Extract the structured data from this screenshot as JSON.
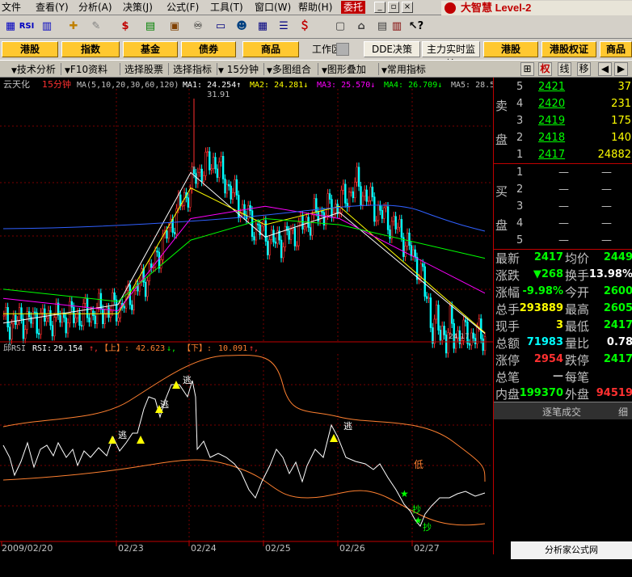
{
  "menu": {
    "items": [
      "文件",
      "查看(Y)",
      "分析(A)",
      "决策(J)",
      "公式(F)",
      "工具(T)",
      "窗口(W)",
      "帮助(H)",
      "委托"
    ],
    "brand": "大智慧 Level-2"
  },
  "sectors": {
    "left": [
      "港股",
      "指数",
      "基金",
      "债券",
      "商品"
    ],
    "workspace_label": "工作区",
    "right": [
      "DDE决策",
      "主力实时监控",
      "港股",
      "港股权证",
      "商品"
    ]
  },
  "toolbar2": {
    "items": [
      "技术分析",
      "F10资料",
      "选择股票",
      "选择指标",
      "15分钟",
      "多图组合",
      "图形叠加",
      "常用指标"
    ],
    "right_tabs": [
      "权",
      "线",
      "移"
    ]
  },
  "main_chart": {
    "stock_name": "云天化",
    "period": "15分钟",
    "ma_def": "MA(5,10,20,30,60,120)",
    "ma": [
      {
        "label": "MA1:",
        "value": "24.254",
        "arrow": "↑",
        "color": "#ffffff"
      },
      {
        "label": "MA2:",
        "value": "24.281",
        "arrow": "↓",
        "color": "#ffff00"
      },
      {
        "label": "MA3:",
        "value": "25.570",
        "arrow": "↓",
        "color": "#ff00ff"
      },
      {
        "label": "MA4:",
        "value": "26.709",
        "arrow": "↓",
        "color": "#00ff00"
      },
      {
        "label": "MA5:",
        "value": "28.5",
        "arrow": "",
        "color": "#c0c0c0"
      }
    ],
    "high_label": "31.91",
    "low_label": "24.17"
  },
  "rsi_chart": {
    "name": "邱RSI",
    "rsi_label": "RSI:",
    "rsi_value": "29.154",
    "rsi_arrow": "↑,",
    "upper_label": "【上】:",
    "upper_value": "42.623",
    "upper_arrow": "↓,",
    "lower_label": "【下】:",
    "lower_value": "10.091",
    "lower_arrow": "↑,",
    "signal_buy": "逃",
    "signal_low": "低",
    "signal_sell": "抄"
  },
  "x_axis": {
    "labels": [
      "2009/02/20",
      "02/23",
      "02/24",
      "02/25",
      "02/26",
      "02/27"
    ]
  },
  "order_book": {
    "sell_label_top": "卖",
    "sell_label_bottom": "盘",
    "buy_label_top": "买",
    "buy_label_bottom": "盘",
    "sell": [
      {
        "level": "5",
        "price": "2421",
        "volume": "37"
      },
      {
        "level": "4",
        "price": "2420",
        "volume": "231"
      },
      {
        "level": "3",
        "price": "2419",
        "volume": "175"
      },
      {
        "level": "2",
        "price": "2418",
        "volume": "140"
      },
      {
        "level": "1",
        "price": "2417",
        "volume": "24882"
      }
    ],
    "buy": [
      {
        "level": "1",
        "price": "—",
        "volume": "—"
      },
      {
        "level": "2",
        "price": "—",
        "volume": "—"
      },
      {
        "level": "3",
        "price": "—",
        "volume": "—"
      },
      {
        "level": "4",
        "price": "—",
        "volume": "—"
      },
      {
        "level": "5",
        "price": "—",
        "volume": "—"
      }
    ]
  },
  "quote": [
    {
      "l1": "最新",
      "v1": "2417",
      "c1": "#00ff00",
      "l2": "均价",
      "v2": "2449",
      "c2": "#00ff00"
    },
    {
      "l1": "涨跌",
      "v1": "▼268",
      "c1": "#00ff00",
      "l2": "换手",
      "v2": "13.98%",
      "c2": "#ffffff"
    },
    {
      "l1": "涨幅",
      "v1": "-9.98%",
      "c1": "#00ff00",
      "l2": "今开",
      "v2": "2600",
      "c2": "#00ff00"
    },
    {
      "l1": "总手",
      "v1": "293889",
      "c1": "#ffff00",
      "l2": "最高",
      "v2": "2605",
      "c2": "#00ff00"
    },
    {
      "l1": "现手",
      "v1": "3",
      "c1": "#ffff00",
      "l2": "最低",
      "v2": "2417",
      "c2": "#00ff00"
    },
    {
      "l1": "总额",
      "v1": "71983",
      "c1": "#00ffff",
      "l2": "量比",
      "v2": "0.78",
      "c2": "#ffffff"
    },
    {
      "l1": "涨停",
      "v1": "2954",
      "c1": "#ff3030",
      "l2": "跌停",
      "v2": "2417",
      "c2": "#00ff00"
    },
    {
      "l1": "总笔",
      "v1": "—",
      "c1": "#c0c0c0",
      "l2": "每笔",
      "v2": "",
      "c2": "#c0c0c0"
    },
    {
      "l1": "内盘",
      "v1": "199370",
      "c1": "#00ff00",
      "l2": "外盘",
      "v2": "94519",
      "c2": "#ff3030"
    }
  ],
  "tick_button": "逐笔成交",
  "tick_side": "细",
  "watermark": "分析家公式网 www.88gs.com",
  "chart_data": {
    "type": "line",
    "x": [
      "2009/02/20",
      "02/23",
      "02/24",
      "02/25",
      "02/26",
      "02/27"
    ],
    "series": [
      {
        "name": "MA1",
        "values": [
          24.6,
          25.2,
          29.5,
          27.4,
          28.2,
          24.254
        ]
      },
      {
        "name": "MA2",
        "values": [
          24.9,
          24.9,
          29.0,
          27.8,
          28.4,
          24.281
        ]
      },
      {
        "name": "MA3",
        "values": [
          25.4,
          25.0,
          28.0,
          28.4,
          28.0,
          25.57
        ]
      },
      {
        "name": "MA4",
        "values": [
          25.7,
          25.3,
          27.3,
          28.0,
          27.8,
          26.709
        ]
      }
    ],
    "ylim": [
      24.17,
      31.91
    ]
  }
}
